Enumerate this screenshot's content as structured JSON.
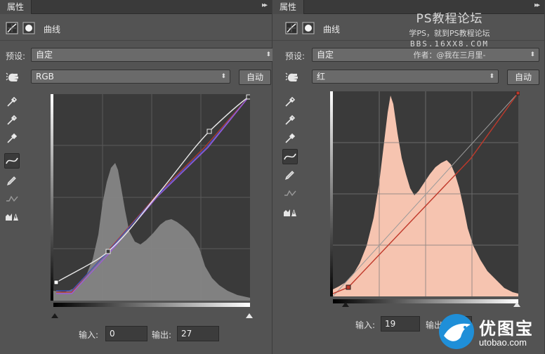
{
  "left_panel": {
    "title_tab": "属性",
    "menu_glyph": "▸▸",
    "header_title": "曲线",
    "preset_label": "预设:",
    "preset_value": "自定",
    "channel_value": "RGB",
    "auto_label": "自动",
    "input_label": "输入:",
    "input_value": "0",
    "output_label": "输出:",
    "output_value": "27"
  },
  "right_panel": {
    "title_tab": "属性",
    "menu_glyph": "▸▸",
    "header_title": "曲线",
    "preset_label": "预设:",
    "preset_value": "自定",
    "channel_value": "红",
    "auto_label": "自动",
    "input_label": "输入:",
    "input_value": "19",
    "output_label": "输出:",
    "output_value": "9"
  },
  "watermark": {
    "line1": "PS教程论坛",
    "line2": "学PS，就到PS教程论坛",
    "line3": "BBS.16XX8.COM",
    "line4": "作者：@我在三月里-"
  },
  "logo": {
    "cn": "优图宝",
    "en": "utobao.com"
  },
  "tools": [
    "eyedropper-black-icon",
    "eyedropper-gray-icon",
    "eyedropper-white-icon",
    "curve-point-icon",
    "pencil-icon",
    "smooth-icon",
    "clipping-warning-icon"
  ],
  "colors": {
    "histogram_gray": "#8a8a8a",
    "histogram_red": "#f6c4b0",
    "curve_white": "#e8e8e8",
    "curve_purple": "#9b5cd6",
    "curve_red": "#c0392b",
    "grid": "#6a6a6a"
  }
}
